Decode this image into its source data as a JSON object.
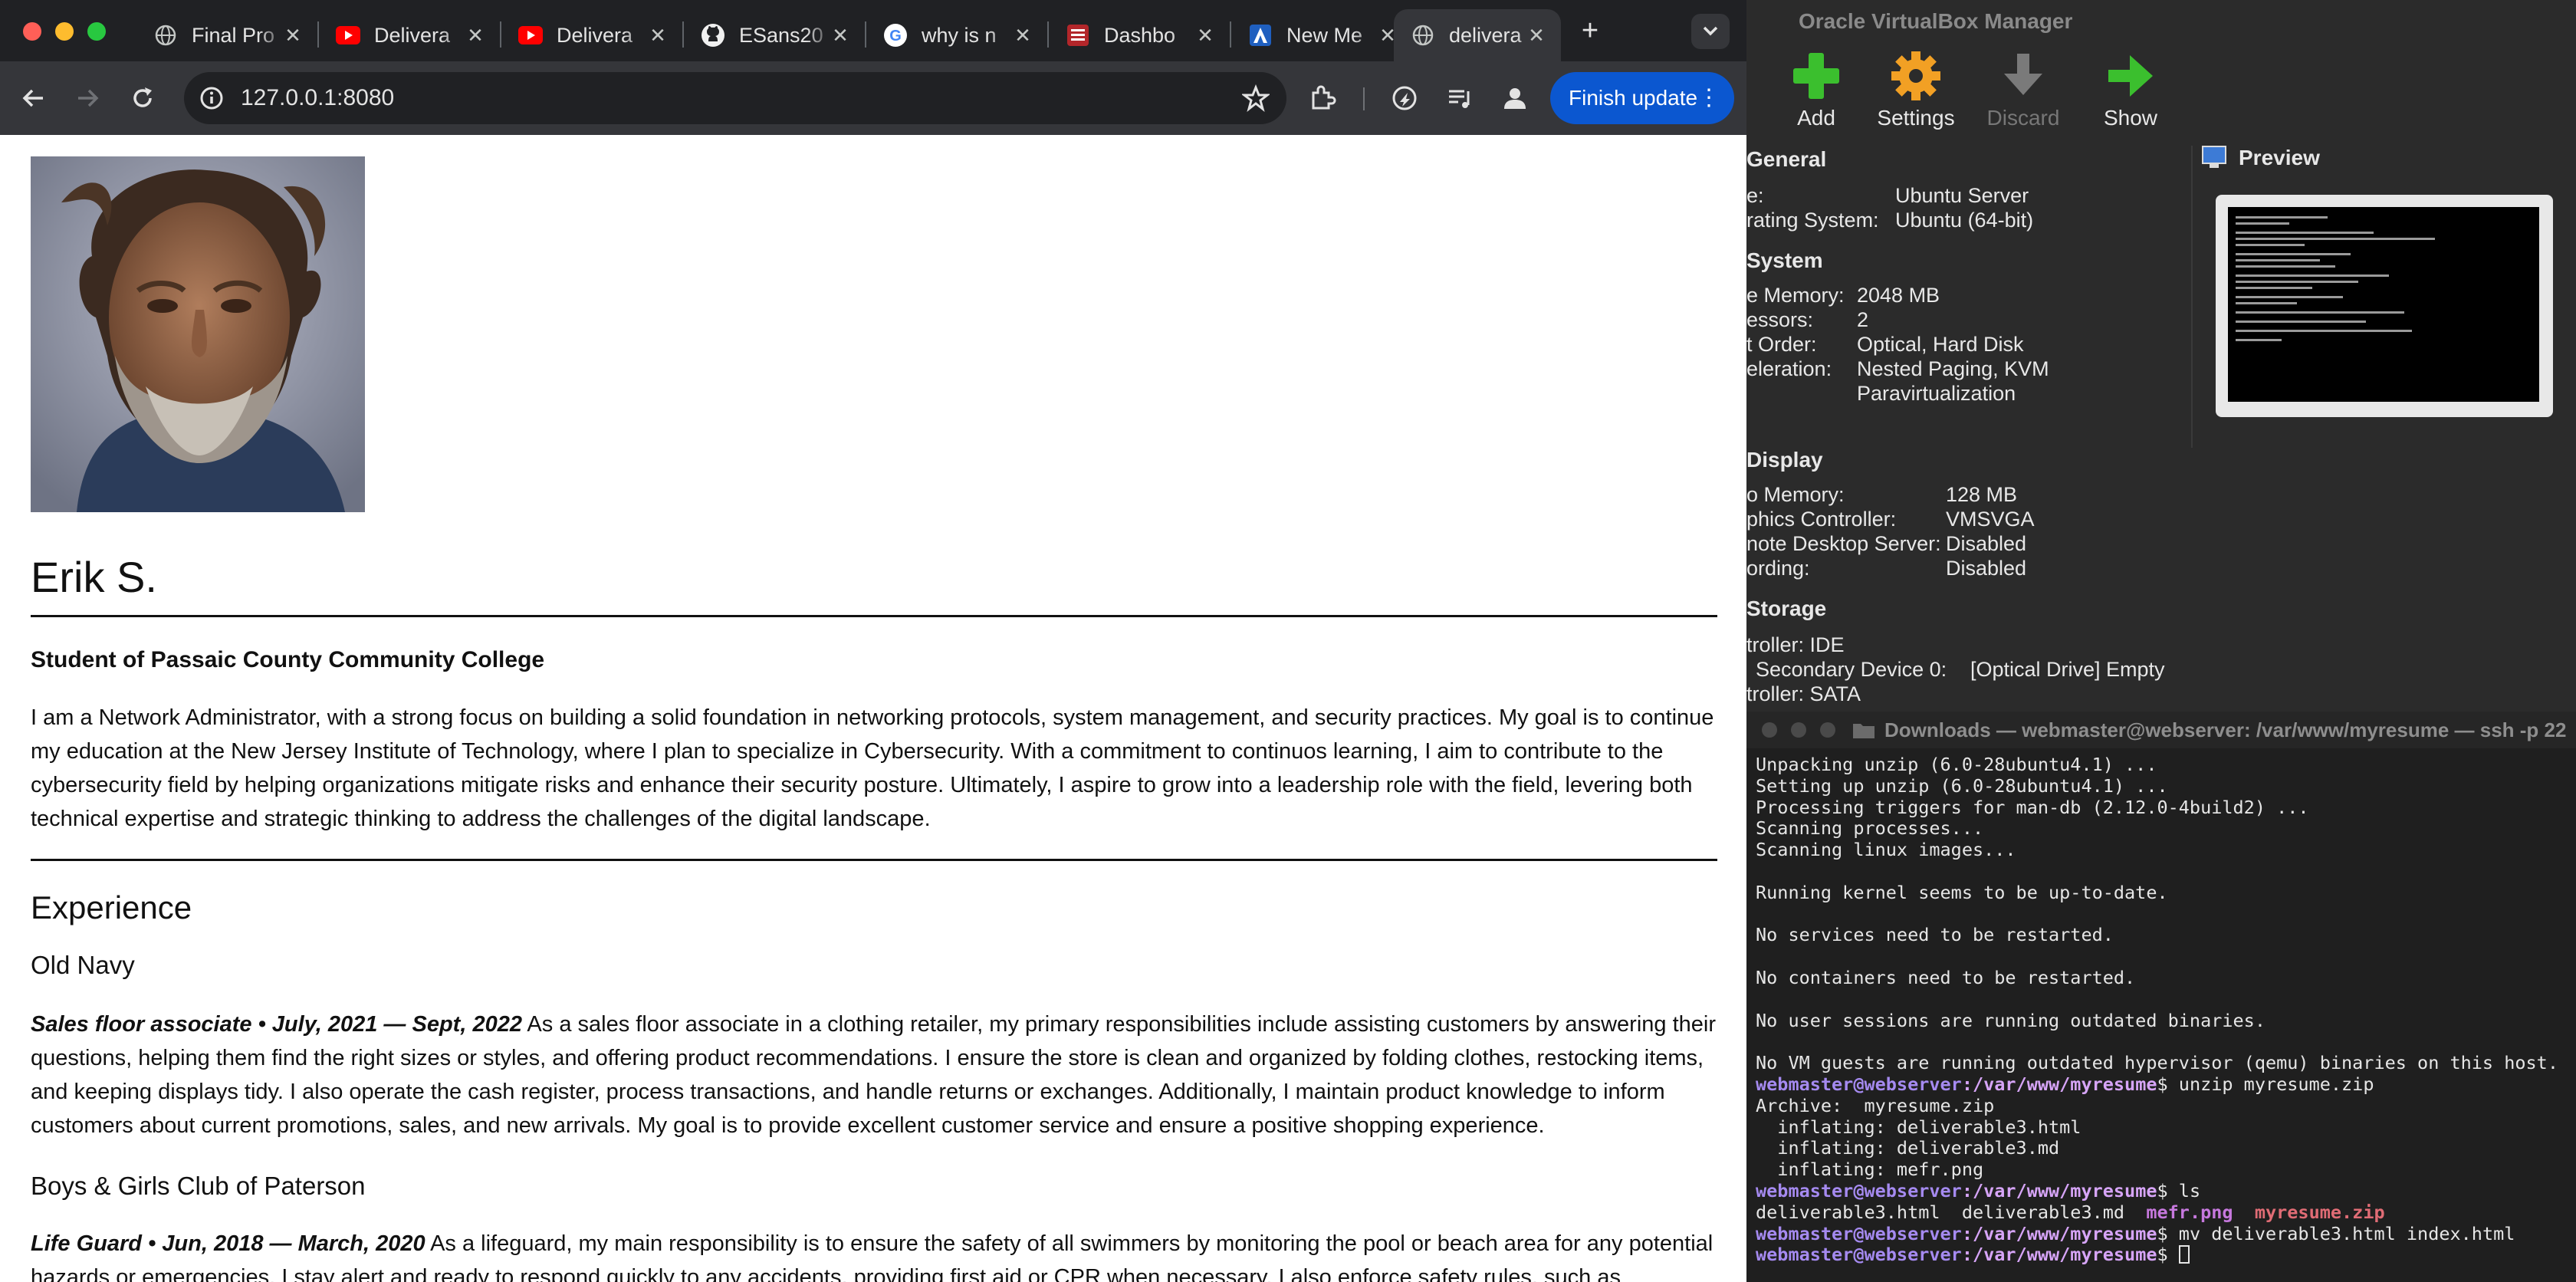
{
  "browser": {
    "tabs": [
      {
        "title": "Final Pro",
        "icon": "globe-icon"
      },
      {
        "title": "Delivera",
        "icon": "youtube-icon"
      },
      {
        "title": "Delivera",
        "icon": "youtube-icon"
      },
      {
        "title": "ESans20",
        "icon": "github-icon"
      },
      {
        "title": "why is n",
        "icon": "google-icon"
      },
      {
        "title": "Dashbo",
        "icon": "dashboard-icon"
      },
      {
        "title": "New Me",
        "icon": "arch-icon"
      },
      {
        "title": "delivera",
        "icon": "globe-icon",
        "active": true
      }
    ],
    "url": "127.0.0.1:8080",
    "finish_update": "Finish update"
  },
  "resume": {
    "name": "Erik S.",
    "subtitle": "Student of Passaic County Community College",
    "summary": "I am a Network Administrator, with a strong focus on building a solid foundation in networking protocols, system management, and security practices. My goal is to continue my education at the New Jersey Institute of Technology, where I plan to specialize in Cybersecurity. With a commitment to continuos learning, I aim to contribute to the cybersecurity field by helping organizations mitigate risks and enhance their security posture. Ultimately, I aspire to grow into a leadership role with the field, levering both technical expertise and strategic thinking to address the challenges of the digital landscape.",
    "experience_heading": "Experience",
    "jobs": [
      {
        "employer": "Old Navy",
        "role": "Sales floor associate • July, 2021 — Sept, 2022",
        "description": " As a sales floor associate in a clothing retailer, my primary responsibilities include assisting customers by answering their questions, helping them find the right sizes or styles, and offering product recommendations. I ensure the store is clean and organized by folding clothes, restocking items, and keeping displays tidy. I also operate the cash register, process transactions, and handle returns or exchanges. Additionally, I maintain product knowledge to inform customers about current promotions, sales, and new arrivals. My goal is to provide excellent customer service and ensure a positive shopping experience."
      },
      {
        "employer": "Boys & Girls Club of Paterson",
        "role": "Life Guard • Jun, 2018 — March, 2020",
        "description": " As a lifeguard, my main responsibility is to ensure the safety of all swimmers by monitoring the pool or beach area for any potential hazards or emergencies. I stay alert and ready to respond quickly to any accidents, providing first aid or CPR when necessary. I also enforce safety rules, such as"
      }
    ]
  },
  "virtualbox": {
    "title": "Oracle VirtualBox Manager",
    "toolbar": [
      "Add",
      "Settings",
      "Discard",
      "Show"
    ],
    "preview_label": "Preview",
    "sections": [
      {
        "title": "General",
        "rows": [
          [
            "e:",
            "Ubuntu Server"
          ],
          [
            "rating System:",
            "Ubuntu (64-bit)"
          ]
        ]
      },
      {
        "title": "System",
        "rows": [
          [
            "e Memory:",
            "2048 MB"
          ],
          [
            "essors:",
            "2"
          ],
          [
            "t Order:",
            "Optical, Hard Disk"
          ],
          [
            "eleration:",
            "Nested Paging, KVM"
          ],
          [
            "",
            "Paravirtualization"
          ]
        ]
      },
      {
        "title": "Display",
        "rows": [
          [
            "o Memory:",
            "128 MB"
          ],
          [
            "phics Controller:",
            "VMSVGA"
          ],
          [
            "note Desktop Server:",
            "Disabled"
          ],
          [
            "ording:",
            "Disabled"
          ]
        ]
      },
      {
        "title": "Storage",
        "rows": [
          [
            "troller: IDE",
            ""
          ],
          [
            "Secondary Device 0:",
            "[Optical Drive] Empty"
          ],
          [
            "troller: SATA",
            ""
          ]
        ]
      }
    ]
  },
  "terminal": {
    "title": "Downloads — webmaster@webserver: /var/www/myresume — ssh -p 22",
    "lines": [
      "Unpacking unzip (6.0-28ubuntu4.1) ...",
      "Setting up unzip (6.0-28ubuntu4.1) ...",
      "Processing triggers for man-db (2.12.0-4build2) ...",
      "Scanning processes...",
      "Scanning linux images...",
      "",
      "Running kernel seems to be up-to-date.",
      "",
      "No services need to be restarted.",
      "",
      "No containers need to be restarted.",
      "",
      "No user sessions are running outdated binaries.",
      "",
      "No VM guests are running outdated hypervisor (qemu) binaries on this host."
    ],
    "prompt_user": "webmaster@webserver",
    "prompt_path": ":/var/www/myresume",
    "cmd1": "$ unzip myresume.zip",
    "unzip_output": [
      "Archive:  myresume.zip",
      "  inflating: deliverable3.html",
      "  inflating: deliverable3.md",
      "  inflating: mefr.png"
    ],
    "cmd2": "$ ls",
    "ls_files": [
      "deliverable3.html",
      "deliverable3.md",
      "mefr.png",
      "myresume.zip"
    ],
    "cmd3": "$ mv deliverable3.html index.html",
    "cmd4": "$ "
  }
}
